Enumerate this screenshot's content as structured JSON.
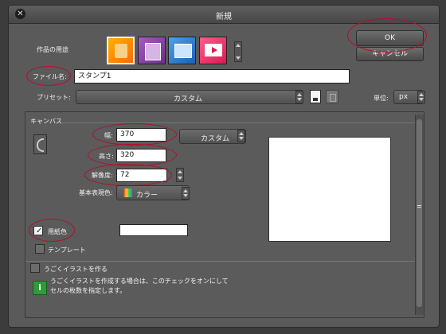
{
  "dialog": {
    "title": "新規",
    "ok_label": "OK",
    "cancel_label": "キャンセル",
    "purpose_label": "作品の用途",
    "filename_label": "ファイル名:",
    "filename_value": "スタンプ1",
    "preset_label": "プリセット:",
    "preset_value": "カスタム",
    "unit_label": "単位:",
    "unit_value": "px"
  },
  "canvas": {
    "section_title": "キャンバス",
    "width_label": "幅:",
    "width_value": "370",
    "height_label": "高さ:",
    "height_value": "320",
    "size_preset_value": "カスタム",
    "resolution_label": "解像度:",
    "resolution_value": "72",
    "color_mode_label": "基本表現色:",
    "color_mode_value": "カラー",
    "paper_color_label": "用紙色",
    "template_label": "テンプレート",
    "animation_label": "うごくイラストを作る",
    "info_line1": "うごくイラストを作成する場合は、このチェックをオンにして",
    "info_line2": "セルの枚数を指定します。"
  },
  "icons": {
    "close": "close-icon",
    "trash": "trash-icon",
    "save_preset": "save-icon",
    "info": "info-icon",
    "orientation": "rotate-icon"
  },
  "colors": {
    "highlight_ring": "#b0102a",
    "info_green": "#2f9a3a"
  }
}
